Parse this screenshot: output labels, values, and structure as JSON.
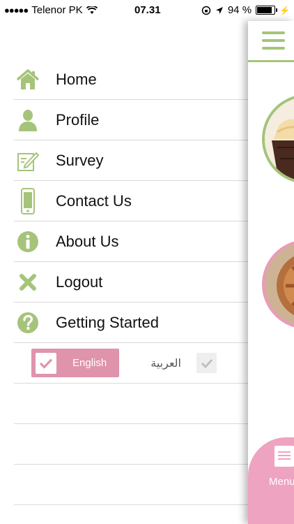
{
  "status_bar": {
    "carrier": "Telenor PK",
    "time": "07.31",
    "battery": "94 %",
    "battery_level": 0.94
  },
  "colors": {
    "accent_green": "#a5c47a",
    "accent_pink": "#df94ab",
    "menu_tab_pink": "#eea3c1"
  },
  "menu": {
    "items": [
      {
        "label": "Home",
        "icon": "home-icon"
      },
      {
        "label": "Profile",
        "icon": "user-icon"
      },
      {
        "label": "Survey",
        "icon": "edit-icon"
      },
      {
        "label": "Contact Us",
        "icon": "phone-icon"
      },
      {
        "label": "About Us",
        "icon": "info-icon"
      },
      {
        "label": "Logout",
        "icon": "close-icon"
      },
      {
        "label": "Getting Started",
        "icon": "help-icon"
      }
    ]
  },
  "language": {
    "english": "English",
    "arabic": "العربية",
    "selected": "English"
  },
  "main_panel": {
    "menu_tab_label": "Menu"
  }
}
